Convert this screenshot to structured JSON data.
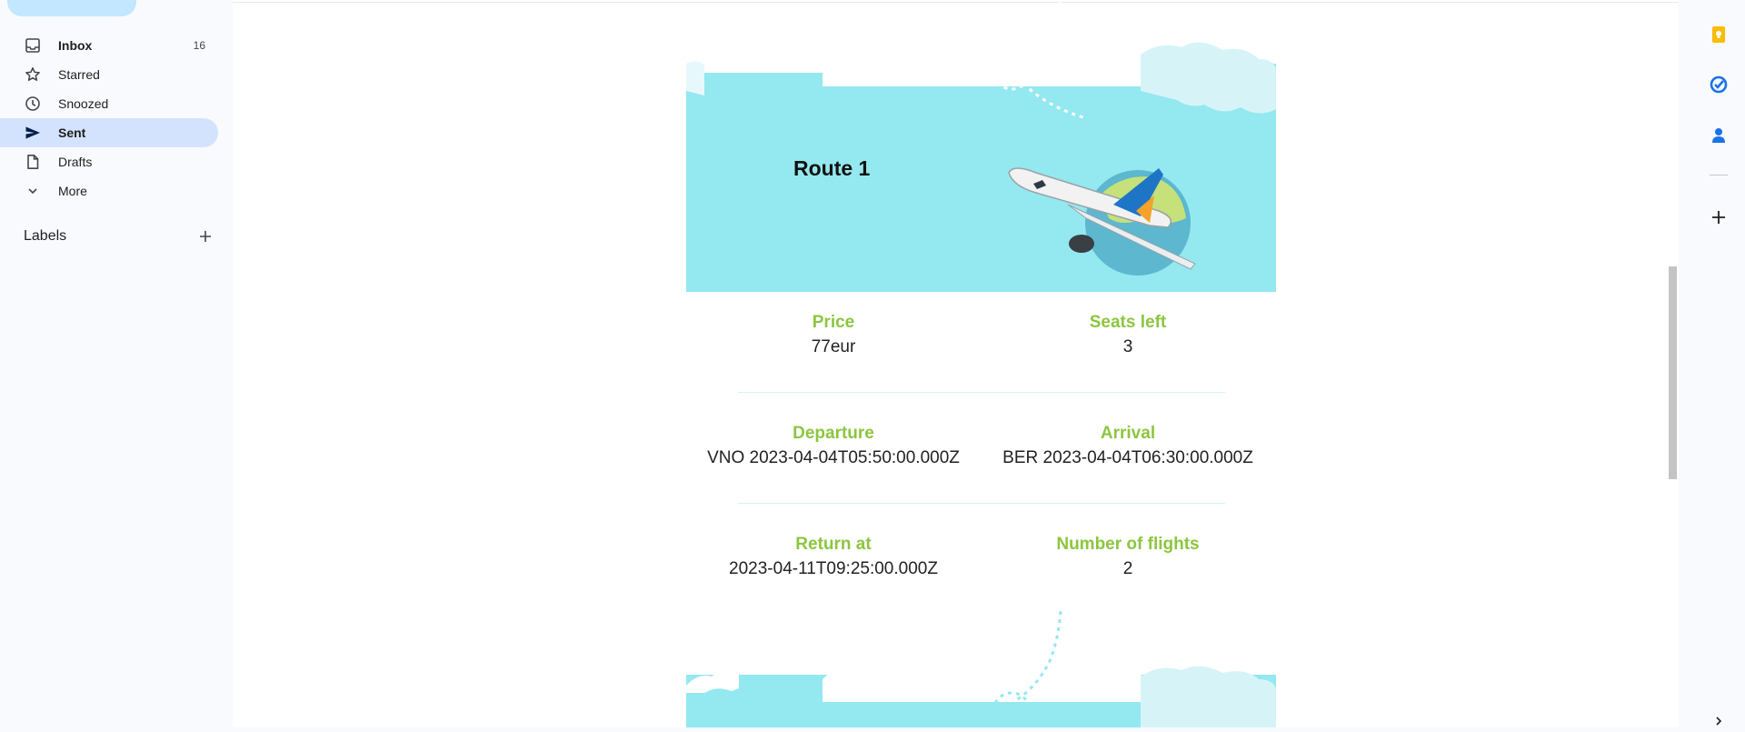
{
  "sidebar": {
    "items": [
      {
        "label": "Inbox",
        "count": "16"
      },
      {
        "label": "Starred",
        "count": ""
      },
      {
        "label": "Snoozed",
        "count": ""
      },
      {
        "label": "Sent",
        "count": ""
      },
      {
        "label": "Drafts",
        "count": ""
      },
      {
        "label": "More",
        "count": ""
      }
    ],
    "labels_heading": "Labels"
  },
  "email": {
    "route_title": "Route 1",
    "price_label": "Price",
    "price_value": "77eur",
    "seats_label": "Seats left",
    "seats_value": "3",
    "departure_label": "Departure",
    "departure_value": "VNO 2023-04-04T05:50:00.000Z",
    "arrival_label": "Arrival",
    "arrival_value": "BER 2023-04-04T06:30:00.000Z",
    "return_label": "Return at",
    "return_value": "2023-04-11T09:25:00.000Z",
    "flights_label": "Number of flights",
    "flights_value": "2"
  },
  "colors": {
    "accent_label": "#8cc63f",
    "sky": "#94e8ef",
    "active_nav": "#d3e3fd"
  },
  "icons": {
    "right_panel": [
      "keep-icon",
      "tasks-icon",
      "contacts-icon",
      "add-icon",
      "expand-icon"
    ]
  }
}
